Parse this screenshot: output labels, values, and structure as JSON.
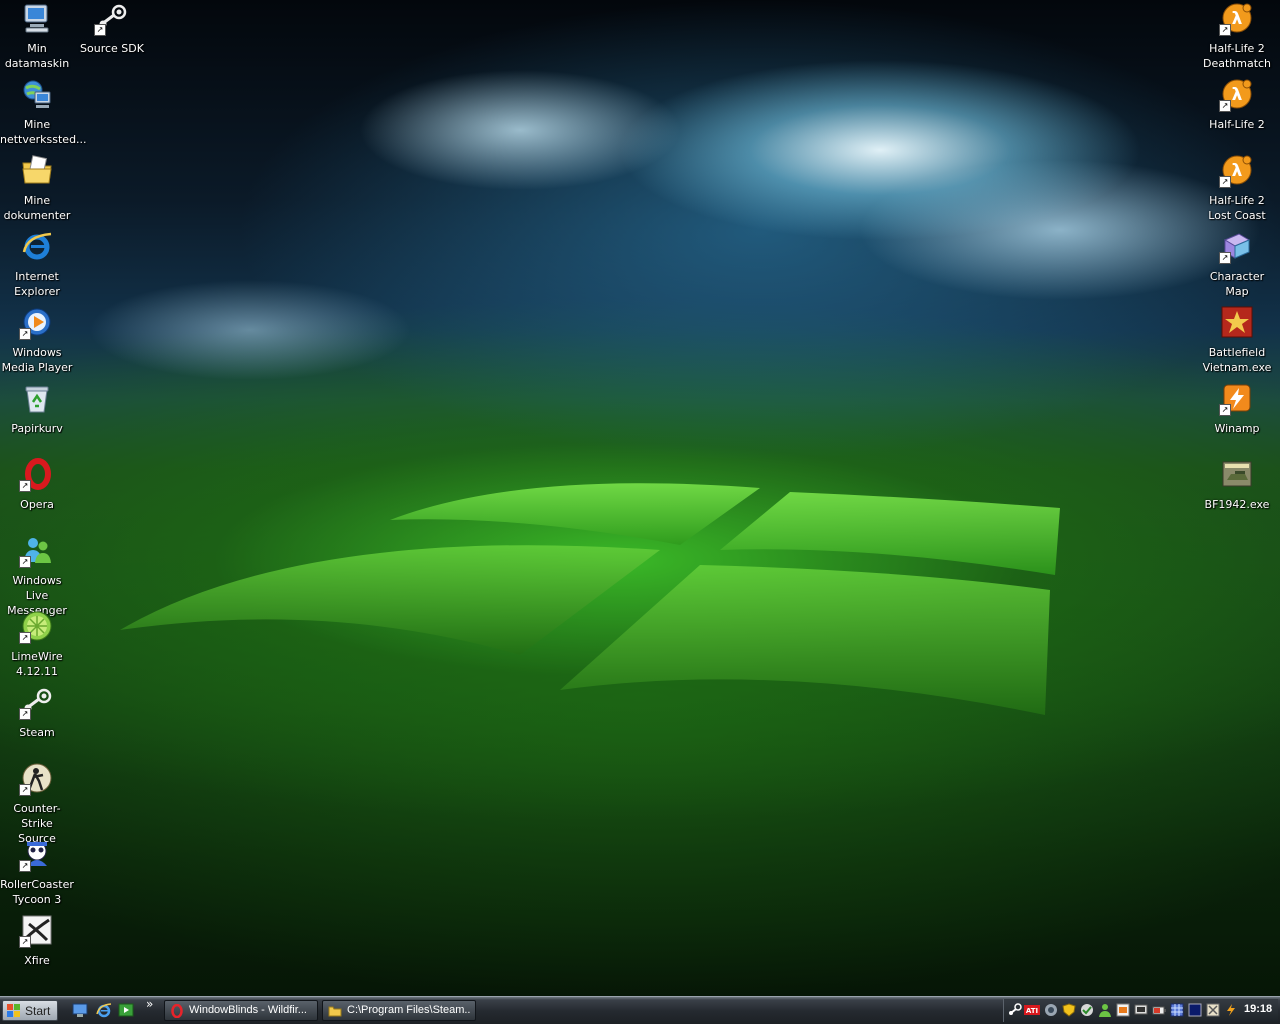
{
  "desktop": {
    "left_icons": [
      {
        "label": "Min\ndatamaskin",
        "icon": "computer-icon"
      },
      {
        "label": "Source SDK",
        "icon": "steam-icon"
      },
      {
        "label": "Mine\nnettverkssted...",
        "icon": "network-places-icon"
      },
      {
        "label": "Mine\ndokumenter",
        "icon": "documents-folder-icon"
      },
      {
        "label": "Internet\nExplorer",
        "icon": "internet-explorer-icon"
      },
      {
        "label": "Windows\nMedia Player",
        "icon": "media-player-icon"
      },
      {
        "label": "Papirkurv",
        "icon": "recycle-bin-icon"
      },
      {
        "label": "Opera",
        "icon": "opera-icon"
      },
      {
        "label": "Windows Live\nMessenger",
        "icon": "messenger-icon"
      },
      {
        "label": "LimeWire\n4.12.11",
        "icon": "limewire-icon"
      },
      {
        "label": "Steam",
        "icon": "steam-icon"
      },
      {
        "label": "Counter-Strike\nSource",
        "icon": "counter-strike-icon"
      },
      {
        "label": "RollerCoaster\nTycoon 3",
        "icon": "rollercoaster-icon"
      },
      {
        "label": "Xfire",
        "icon": "xfire-icon"
      }
    ],
    "right_icons": [
      {
        "label": "Half-Life 2\nDeathmatch",
        "icon": "half-life-icon"
      },
      {
        "label": "Half-Life 2",
        "icon": "half-life-icon"
      },
      {
        "label": "Half-Life 2\nLost Coast",
        "icon": "half-life-icon"
      },
      {
        "label": "Character\nMap",
        "icon": "character-map-icon"
      },
      {
        "label": "Battlefield\nVietnam.exe",
        "icon": "battlefield-vietnam-icon"
      },
      {
        "label": "Winamp",
        "icon": "winamp-icon"
      },
      {
        "label": "BF1942.exe",
        "icon": "bf1942-icon"
      }
    ]
  },
  "taskbar": {
    "start_label": "Start",
    "quick_launch": [
      "desktop-show-icon",
      "internet-explorer-icon",
      "media-icon"
    ],
    "chevron": "»",
    "tasks": [
      {
        "label": "WindowBlinds - Wildfir...",
        "icon": "opera-icon"
      },
      {
        "label": "C:\\Program Files\\Steam...",
        "icon": "folder-icon"
      }
    ],
    "tray": {
      "clock": "19:18"
    }
  },
  "colors": {
    "taskbar_dark": "#1c2024",
    "label_text": "#ffffff",
    "grass": "#3fbf2a"
  }
}
